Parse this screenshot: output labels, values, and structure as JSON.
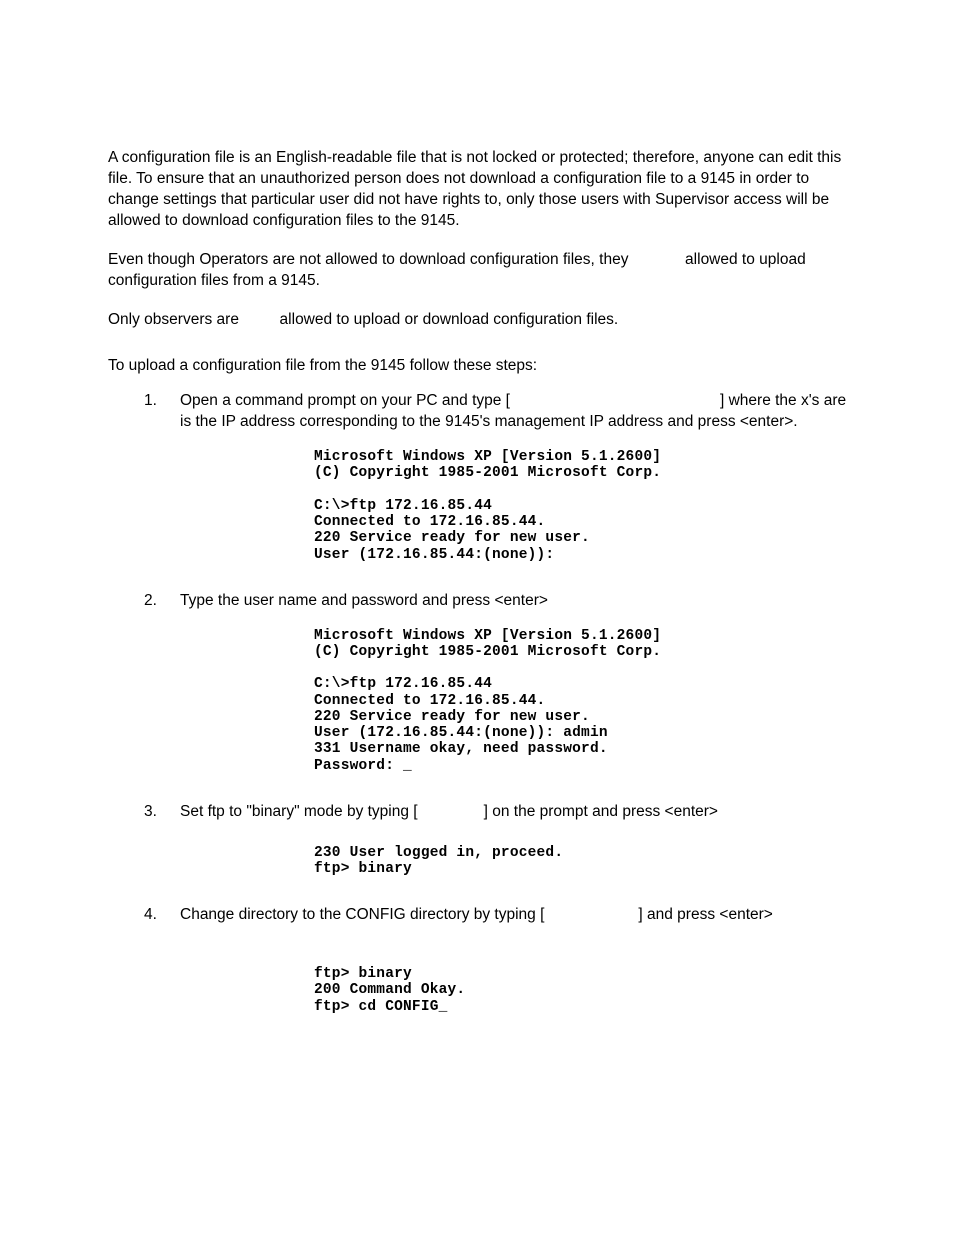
{
  "intro": {
    "p1": "A configuration file is an English-readable file that is not locked or protected; therefore, anyone can edit this file.  To ensure that an unauthorized person does not download a configuration file to a 9145 in order to change settings that particular user did not have rights to, only those users with Supervisor access will be allowed to download configuration files to the 9145.",
    "p2_a": "Even though Operators are not allowed to download configuration files, they ",
    "p2_b": " allowed to upload configuration files from a 9145.",
    "p3_a": "Only observers are ",
    "p3_b": " allowed to upload or download configuration files."
  },
  "lead": "To upload a configuration file from the 9145 follow these steps:",
  "steps": {
    "s1": {
      "num": "1.",
      "a": "Open a command prompt on your PC and type [",
      "b": "] where the x's are is the IP address corresponding to the 9145's management IP address and press <enter>."
    },
    "s2": {
      "num": "2.",
      "text": "Type the user name and password and press <enter>"
    },
    "s3": {
      "num": "3.",
      "a": "Set ftp to \"binary\" mode by typing [",
      "b": "] on the prompt and press <enter>"
    },
    "s4": {
      "num": "4.",
      "a": "Change directory to the CONFIG directory by typing [",
      "b": "] and press <enter>"
    }
  },
  "terminals": {
    "t1": "Microsoft Windows XP [Version 5.1.2600]\n(C) Copyright 1985-2001 Microsoft Corp.\n\nC:\\>ftp 172.16.85.44\nConnected to 172.16.85.44.\n220 Service ready for new user.\nUser (172.16.85.44:(none)):",
    "t2": "Microsoft Windows XP [Version 5.1.2600]\n(C) Copyright 1985-2001 Microsoft Corp.\n\nC:\\>ftp 172.16.85.44\nConnected to 172.16.85.44.\n220 Service ready for new user.\nUser (172.16.85.44:(none)): admin\n331 Username okay, need password.\nPassword: _",
    "t3": "230 User logged in, proceed.\nftp> binary",
    "t4": "ftp> binary\n200 Command Okay.\nftp> cd CONFIG_"
  }
}
